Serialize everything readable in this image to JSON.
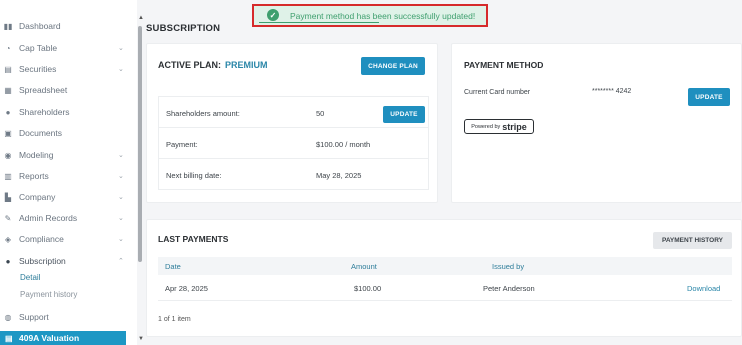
{
  "toast": {
    "message": "Payment method has been successfully updated!"
  },
  "sidebar": {
    "items": [
      {
        "label": "Dashboard",
        "icon": "dashboard-icon",
        "glyph": "▮▮",
        "chevron": ""
      },
      {
        "label": "Cap Table",
        "icon": "pie-chart-icon",
        "glyph": "◔",
        "chevron": "⌄"
      },
      {
        "label": "Securities",
        "icon": "clipboard-icon",
        "glyph": "▤",
        "chevron": "⌄"
      },
      {
        "label": "Spreadsheet",
        "icon": "spreadsheet-icon",
        "glyph": "▦",
        "chevron": ""
      },
      {
        "label": "Shareholders",
        "icon": "user-icon",
        "glyph": "●",
        "chevron": ""
      },
      {
        "label": "Documents",
        "icon": "document-icon",
        "glyph": "▣",
        "chevron": ""
      },
      {
        "label": "Modeling",
        "icon": "lightbulb-icon",
        "glyph": "◉",
        "chevron": "⌄"
      },
      {
        "label": "Reports",
        "icon": "report-icon",
        "glyph": "▥",
        "chevron": "⌄"
      },
      {
        "label": "Company",
        "icon": "building-icon",
        "glyph": "▙",
        "chevron": "⌄"
      },
      {
        "label": "Admin Records",
        "icon": "pen-icon",
        "glyph": "✎",
        "chevron": "⌄"
      },
      {
        "label": "Compliance",
        "icon": "shield-icon",
        "glyph": "◈",
        "chevron": "⌄"
      },
      {
        "label": "Subscription",
        "icon": "dollar-icon",
        "glyph": "●",
        "chevron": "⌃"
      }
    ],
    "sub_items": [
      "Detail",
      "Payment history"
    ],
    "support": {
      "label": "Support",
      "glyph": "◍"
    },
    "bottom": {
      "label": "409A Valuation",
      "glyph": "▤"
    }
  },
  "page": {
    "title": "SUBSCRIPTION"
  },
  "plan_card": {
    "active_label": "ACTIVE PLAN:",
    "plan_name": "PREMIUM",
    "change_button": "CHANGE PLAN",
    "rows": [
      {
        "key": "Shareholders amount:",
        "value": "50"
      },
      {
        "key": "Payment:",
        "value": "$100.00 / month"
      },
      {
        "key": "Next billing date:",
        "value": "May 28, 2025"
      }
    ],
    "update_button": "UPDATE"
  },
  "method_card": {
    "title": "PAYMENT METHOD",
    "card_label": "Current Card number",
    "card_number": "******** 4242",
    "update_button": "UPDATE",
    "stripe_powered": "Powered by",
    "stripe_brand": "stripe"
  },
  "payments": {
    "title": "LAST PAYMENTS",
    "history_button": "PAYMENT HISTORY",
    "columns": [
      "Date",
      "Amount",
      "Issued by"
    ],
    "rows": [
      {
        "date": "Apr 28, 2025",
        "amount": "$100.00",
        "issued_by": "Peter Anderson",
        "action": "Download"
      }
    ],
    "pager": "1 of 1 item"
  },
  "colors": {
    "accent": "#1f8fbf",
    "success": "#3e9f6e",
    "highlight_border": "#d62b2b"
  }
}
